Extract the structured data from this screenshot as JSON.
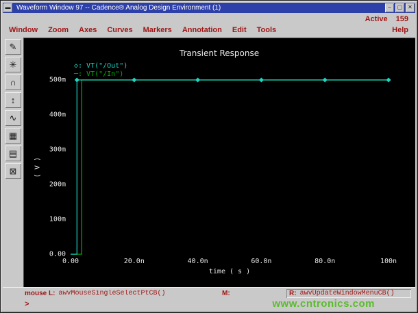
{
  "window": {
    "title": "Waveform Window 97 -- Cadence® Analog Design Environment (1)",
    "active_label": "Active",
    "active_value": "159",
    "help_label": "Help"
  },
  "icons": {
    "window_menu": "▬",
    "minimize": "–",
    "maximize": "▢",
    "close": "✕"
  },
  "menubar": {
    "items": [
      "Window",
      "Zoom",
      "Axes",
      "Curves",
      "Markers",
      "Annotation",
      "Edit",
      "Tools"
    ]
  },
  "toolbar": {
    "tools": [
      {
        "name": "pencil-tool",
        "glyph": "✎"
      },
      {
        "name": "zoom-fit-tool",
        "glyph": "✳"
      },
      {
        "name": "redraw-tool",
        "glyph": "∩"
      },
      {
        "name": "strip-chart-tool",
        "glyph": "↕"
      },
      {
        "name": "subwaveform-tool",
        "glyph": "∿"
      },
      {
        "name": "data-table-tool",
        "glyph": "▦"
      },
      {
        "name": "copy-window-tool",
        "glyph": "▤"
      },
      {
        "name": "delete-tool",
        "glyph": "⊠"
      }
    ]
  },
  "chart_data": {
    "type": "line",
    "title": "Transient Response",
    "xlabel": "time ( s )",
    "ylabel": "( V )",
    "xlim": [
      0,
      100
    ],
    "ylim": [
      0,
      0.5
    ],
    "x_unit": "ns",
    "y_unit": "V",
    "grid": false,
    "background": "#000000",
    "legend_position": "top-left",
    "x_ticks": [
      "0.00",
      "20.0n",
      "40.0n",
      "60.0n",
      "80.0n",
      "100n"
    ],
    "y_ticks": [
      "500m",
      "400m",
      "300m",
      "200m",
      "100m",
      "0.00"
    ],
    "series": [
      {
        "id": "in",
        "name": "VT(\"/In\")",
        "color": "#00b400",
        "points": [
          [
            0,
            0
          ],
          [
            3.5,
            0
          ],
          [
            3.5,
            0.5
          ],
          [
            100,
            0.5
          ]
        ]
      },
      {
        "id": "out",
        "name": "VT(\"/Out\")",
        "color": "#1ed6c3",
        "points": [
          [
            0,
            0
          ],
          [
            2,
            0
          ],
          [
            2,
            0.5
          ],
          [
            100,
            0.5
          ]
        ],
        "markers_x": [
          2,
          20,
          40,
          60,
          80,
          100
        ],
        "marker_y": 0.5,
        "marker": "diamond"
      }
    ],
    "legend": [
      {
        "label": "VT(\"/Out\")",
        "color": "#1ed6c3",
        "symbol": "◇"
      },
      {
        "label": "VT(\"/In\")",
        "color": "#00b400",
        "symbol": "─"
      }
    ]
  },
  "statusbar": {
    "left_label": "mouse L:",
    "left_cmd": "awvMouseSingleSelectPtCB()",
    "middle_label": "M:",
    "right_label": "R:",
    "right_cmd": "awvUpdateWindowMenuCB()"
  },
  "prompt_label": ">",
  "watermark": "www.cntronics.com"
}
